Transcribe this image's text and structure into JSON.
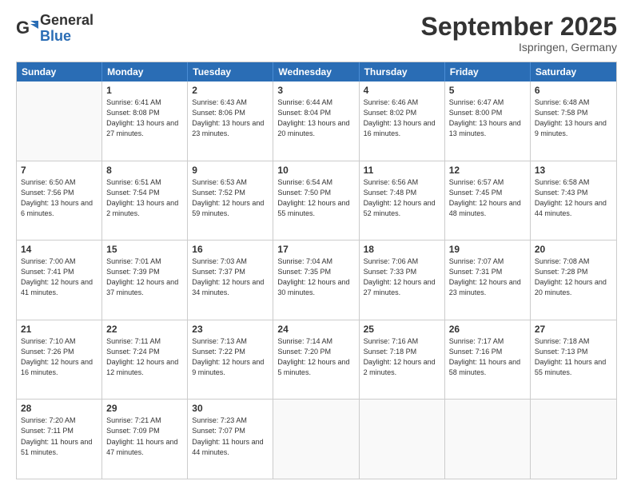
{
  "logo": {
    "general": "General",
    "blue": "Blue"
  },
  "header": {
    "title": "September 2025",
    "location": "Ispringen, Germany"
  },
  "days": [
    "Sunday",
    "Monday",
    "Tuesday",
    "Wednesday",
    "Thursday",
    "Friday",
    "Saturday"
  ],
  "weeks": [
    [
      {
        "day": "",
        "sunrise": "",
        "sunset": "",
        "daylight": ""
      },
      {
        "day": "1",
        "sunrise": "Sunrise: 6:41 AM",
        "sunset": "Sunset: 8:08 PM",
        "daylight": "Daylight: 13 hours and 27 minutes."
      },
      {
        "day": "2",
        "sunrise": "Sunrise: 6:43 AM",
        "sunset": "Sunset: 8:06 PM",
        "daylight": "Daylight: 13 hours and 23 minutes."
      },
      {
        "day": "3",
        "sunrise": "Sunrise: 6:44 AM",
        "sunset": "Sunset: 8:04 PM",
        "daylight": "Daylight: 13 hours and 20 minutes."
      },
      {
        "day": "4",
        "sunrise": "Sunrise: 6:46 AM",
        "sunset": "Sunset: 8:02 PM",
        "daylight": "Daylight: 13 hours and 16 minutes."
      },
      {
        "day": "5",
        "sunrise": "Sunrise: 6:47 AM",
        "sunset": "Sunset: 8:00 PM",
        "daylight": "Daylight: 13 hours and 13 minutes."
      },
      {
        "day": "6",
        "sunrise": "Sunrise: 6:48 AM",
        "sunset": "Sunset: 7:58 PM",
        "daylight": "Daylight: 13 hours and 9 minutes."
      }
    ],
    [
      {
        "day": "7",
        "sunrise": "Sunrise: 6:50 AM",
        "sunset": "Sunset: 7:56 PM",
        "daylight": "Daylight: 13 hours and 6 minutes."
      },
      {
        "day": "8",
        "sunrise": "Sunrise: 6:51 AM",
        "sunset": "Sunset: 7:54 PM",
        "daylight": "Daylight: 13 hours and 2 minutes."
      },
      {
        "day": "9",
        "sunrise": "Sunrise: 6:53 AM",
        "sunset": "Sunset: 7:52 PM",
        "daylight": "Daylight: 12 hours and 59 minutes."
      },
      {
        "day": "10",
        "sunrise": "Sunrise: 6:54 AM",
        "sunset": "Sunset: 7:50 PM",
        "daylight": "Daylight: 12 hours and 55 minutes."
      },
      {
        "day": "11",
        "sunrise": "Sunrise: 6:56 AM",
        "sunset": "Sunset: 7:48 PM",
        "daylight": "Daylight: 12 hours and 52 minutes."
      },
      {
        "day": "12",
        "sunrise": "Sunrise: 6:57 AM",
        "sunset": "Sunset: 7:45 PM",
        "daylight": "Daylight: 12 hours and 48 minutes."
      },
      {
        "day": "13",
        "sunrise": "Sunrise: 6:58 AM",
        "sunset": "Sunset: 7:43 PM",
        "daylight": "Daylight: 12 hours and 44 minutes."
      }
    ],
    [
      {
        "day": "14",
        "sunrise": "Sunrise: 7:00 AM",
        "sunset": "Sunset: 7:41 PM",
        "daylight": "Daylight: 12 hours and 41 minutes."
      },
      {
        "day": "15",
        "sunrise": "Sunrise: 7:01 AM",
        "sunset": "Sunset: 7:39 PM",
        "daylight": "Daylight: 12 hours and 37 minutes."
      },
      {
        "day": "16",
        "sunrise": "Sunrise: 7:03 AM",
        "sunset": "Sunset: 7:37 PM",
        "daylight": "Daylight: 12 hours and 34 minutes."
      },
      {
        "day": "17",
        "sunrise": "Sunrise: 7:04 AM",
        "sunset": "Sunset: 7:35 PM",
        "daylight": "Daylight: 12 hours and 30 minutes."
      },
      {
        "day": "18",
        "sunrise": "Sunrise: 7:06 AM",
        "sunset": "Sunset: 7:33 PM",
        "daylight": "Daylight: 12 hours and 27 minutes."
      },
      {
        "day": "19",
        "sunrise": "Sunrise: 7:07 AM",
        "sunset": "Sunset: 7:31 PM",
        "daylight": "Daylight: 12 hours and 23 minutes."
      },
      {
        "day": "20",
        "sunrise": "Sunrise: 7:08 AM",
        "sunset": "Sunset: 7:28 PM",
        "daylight": "Daylight: 12 hours and 20 minutes."
      }
    ],
    [
      {
        "day": "21",
        "sunrise": "Sunrise: 7:10 AM",
        "sunset": "Sunset: 7:26 PM",
        "daylight": "Daylight: 12 hours and 16 minutes."
      },
      {
        "day": "22",
        "sunrise": "Sunrise: 7:11 AM",
        "sunset": "Sunset: 7:24 PM",
        "daylight": "Daylight: 12 hours and 12 minutes."
      },
      {
        "day": "23",
        "sunrise": "Sunrise: 7:13 AM",
        "sunset": "Sunset: 7:22 PM",
        "daylight": "Daylight: 12 hours and 9 minutes."
      },
      {
        "day": "24",
        "sunrise": "Sunrise: 7:14 AM",
        "sunset": "Sunset: 7:20 PM",
        "daylight": "Daylight: 12 hours and 5 minutes."
      },
      {
        "day": "25",
        "sunrise": "Sunrise: 7:16 AM",
        "sunset": "Sunset: 7:18 PM",
        "daylight": "Daylight: 12 hours and 2 minutes."
      },
      {
        "day": "26",
        "sunrise": "Sunrise: 7:17 AM",
        "sunset": "Sunset: 7:16 PM",
        "daylight": "Daylight: 11 hours and 58 minutes."
      },
      {
        "day": "27",
        "sunrise": "Sunrise: 7:18 AM",
        "sunset": "Sunset: 7:13 PM",
        "daylight": "Daylight: 11 hours and 55 minutes."
      }
    ],
    [
      {
        "day": "28",
        "sunrise": "Sunrise: 7:20 AM",
        "sunset": "Sunset: 7:11 PM",
        "daylight": "Daylight: 11 hours and 51 minutes."
      },
      {
        "day": "29",
        "sunrise": "Sunrise: 7:21 AM",
        "sunset": "Sunset: 7:09 PM",
        "daylight": "Daylight: 11 hours and 47 minutes."
      },
      {
        "day": "30",
        "sunrise": "Sunrise: 7:23 AM",
        "sunset": "Sunset: 7:07 PM",
        "daylight": "Daylight: 11 hours and 44 minutes."
      },
      {
        "day": "",
        "sunrise": "",
        "sunset": "",
        "daylight": ""
      },
      {
        "day": "",
        "sunrise": "",
        "sunset": "",
        "daylight": ""
      },
      {
        "day": "",
        "sunrise": "",
        "sunset": "",
        "daylight": ""
      },
      {
        "day": "",
        "sunrise": "",
        "sunset": "",
        "daylight": ""
      }
    ]
  ]
}
